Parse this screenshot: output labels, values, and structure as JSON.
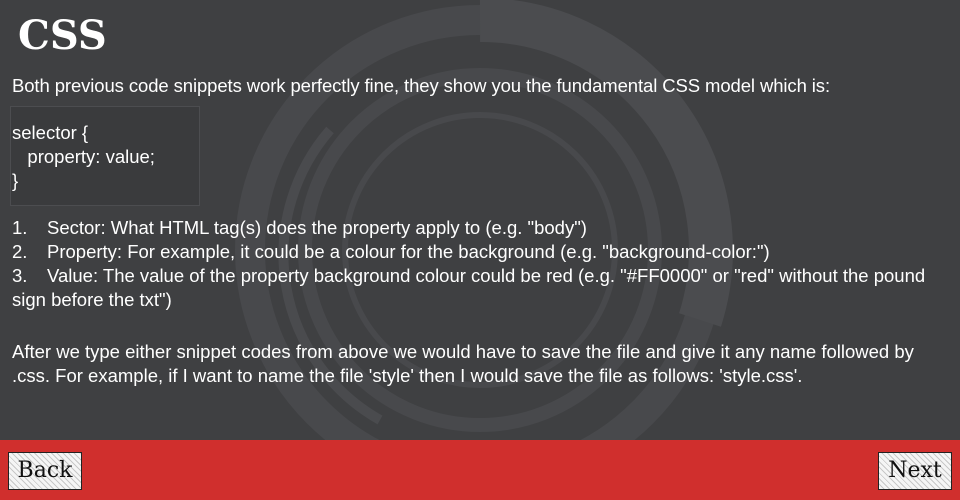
{
  "slide": {
    "title": "CSS",
    "intro": "Both previous code snippets work perfectly fine, they show you the fundamental CSS model which is:",
    "code_lines": [
      "selector {",
      "   property: value;",
      "}"
    ],
    "list": [
      {
        "number": "1.",
        "text": "Sector: What HTML tag(s) does the property apply to (e.g. \"body\")"
      },
      {
        "number": "2.",
        "text": "Property: For example, it could be a colour for the background (e.g. \"background-color:\")"
      },
      {
        "number": "3.",
        "text": "Value: The value of the property background colour could be red (e.g. \"#FF0000\" or \"red\" without the pound sign before the txt\")"
      }
    ],
    "paragraph": "After we type either snippet codes from above we would have to save the file and give it any name followed by .css. For example, if I want to name the file 'style' then I would save the file as follows:  'style.css'."
  },
  "nav": {
    "back_label": "Back",
    "next_label": "Next"
  },
  "colors": {
    "background": "#3f4042",
    "footer": "#d02f2d",
    "text": "#ffffff"
  }
}
